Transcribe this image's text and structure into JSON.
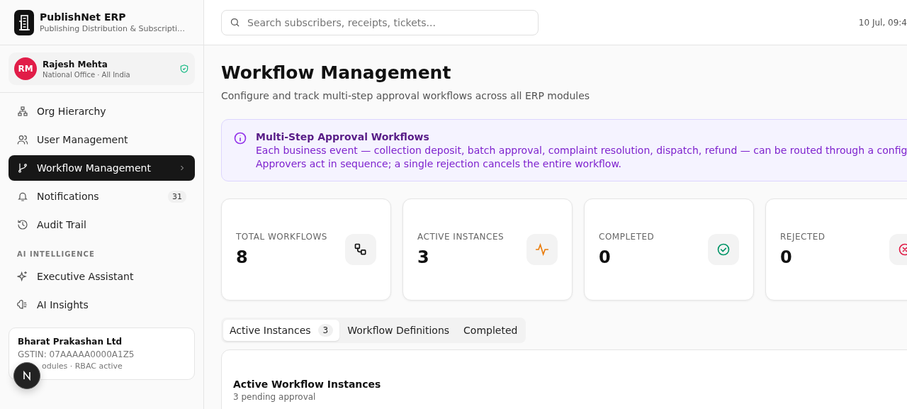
{
  "brand": {
    "name": "PublishNet ERP",
    "subtitle": "Publishing Distribution & Subscripti…"
  },
  "user": {
    "initials": "RM",
    "name": "Rajesh Mehta",
    "office": "National Office · All India",
    "verified": true
  },
  "nav": [
    {
      "label": "Org Hierarchy",
      "selected": false
    },
    {
      "label": "User Management",
      "selected": false
    },
    {
      "label": "Workflow Management",
      "selected": true
    },
    {
      "label": "Notifications",
      "selected": false,
      "badge": "31"
    },
    {
      "label": "Audit Trail",
      "selected": false
    }
  ],
  "ai_section": {
    "heading": "AI INTELLIGENCE",
    "items": [
      {
        "label": "Executive Assistant",
        "selected": false
      },
      {
        "label": "AI Insights",
        "selected": false
      }
    ]
  },
  "company": {
    "name": "Bharat Prakashan Ltd",
    "gstin": "GSTIN: 07AAAAA0000A1Z5",
    "status": "odules · RBAC active"
  },
  "header": {
    "search_placeholder": "Search subscribers, receipts, tickets...",
    "datetime": "10 Jul, 09:4"
  },
  "page": {
    "title": "Workflow Management",
    "subtitle": "Configure and track multi-step approval workflows across all ERP modules"
  },
  "banner": {
    "title": "Multi-Step Approval Workflows",
    "lines": [
      "Each business event — collection deposit, batch approval, complaint resolution, dispatch, refund — can be routed through a config",
      "Approvers act in sequence; a single rejection cancels the entire workflow."
    ]
  },
  "stats": [
    {
      "label": "TOTAL WORKFLOWS",
      "value": "8"
    },
    {
      "label": "ACTIVE INSTANCES",
      "value": "3"
    },
    {
      "label": "COMPLETED",
      "value": "0"
    },
    {
      "label": "REJECTED",
      "value": "0"
    }
  ],
  "tabs": [
    {
      "label": "Active Instances",
      "count": "3",
      "selected": true
    },
    {
      "label": "Workflow Definitions",
      "selected": false
    },
    {
      "label": "Completed",
      "selected": false
    }
  ],
  "panel": {
    "title": "Active Workflow Instances",
    "subtitle": "3 pending approval"
  }
}
